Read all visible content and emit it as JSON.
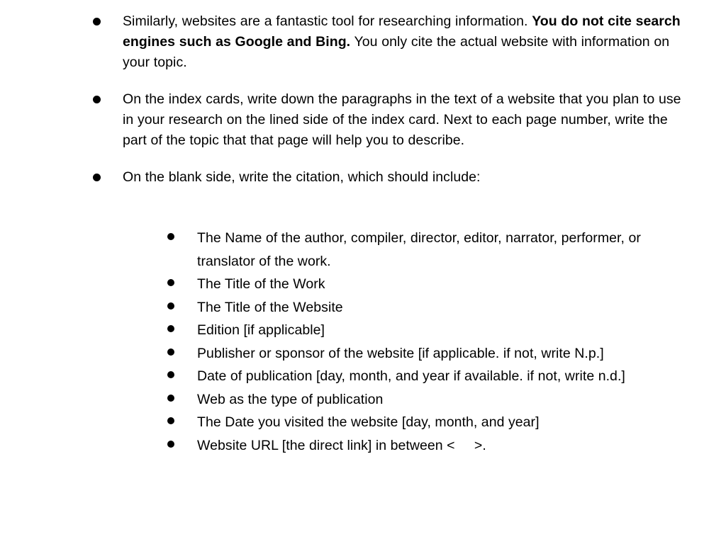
{
  "slide": {
    "background_color": "#ffffff",
    "text_color": "#000000",
    "bullet_glyph": "filled-round-bullet",
    "bullets": [
      {
        "id": "websites-research-tool",
        "segments": [
          {
            "text": "Similarly, websites are a fantastic tool for researching information. ",
            "bold": false
          },
          {
            "text": "You do not cite search engines such as Google and Bing.",
            "bold": true
          },
          {
            "text": " You only cite the actual website with information on your topic.",
            "bold": false
          }
        ],
        "plain": "Similarly, websites are a fantastic tool for researching information. You do not cite search engines such as Google and Bing. You only cite the actual website with information on your topic."
      },
      {
        "id": "index-cards-instructions",
        "segments": [
          {
            "text": "On the index cards, write down the paragraphs in the text of a website that you plan to use in your research on the lined side of the index card. Next to each page number, write the part of the topic that that page will help you to describe.",
            "bold": false
          }
        ],
        "plain": "On the index cards, write down the paragraphs in the text of a website that you plan to use in your research on the lined side of the index card. Next to each page number, write the part of the topic that that page will help you to describe."
      },
      {
        "id": "blank-side-citation",
        "segments": [
          {
            "text": "On the blank side, write the citation, which should include:",
            "bold": false
          }
        ],
        "plain": "On the blank side, write the citation, which should include:"
      }
    ],
    "sub_bullets": [
      {
        "id": "author-name",
        "text": "The Name of the author, compiler, director, editor, narrator, performer, or translator of the work."
      },
      {
        "id": "title-of-work",
        "text": "The Title of the Work"
      },
      {
        "id": "title-of-website",
        "text": "The Title of the Website"
      },
      {
        "id": "edition",
        "text": "Edition [if applicable]"
      },
      {
        "id": "publisher-or-sponsor",
        "text": "Publisher or sponsor of the website [if applicable. if not, write N.p.]"
      },
      {
        "id": "date-of-publication",
        "text": "Date of publication [day, month, and year if available. if not, write n.d.]"
      },
      {
        "id": "type-of-publication",
        "text": "Web as the type of publication"
      },
      {
        "id": "date-visited",
        "text": "The Date you visited the website [day, month, and year]"
      },
      {
        "id": "website-url",
        "text": "Website URL [the direct link] in between <     >."
      }
    ]
  }
}
